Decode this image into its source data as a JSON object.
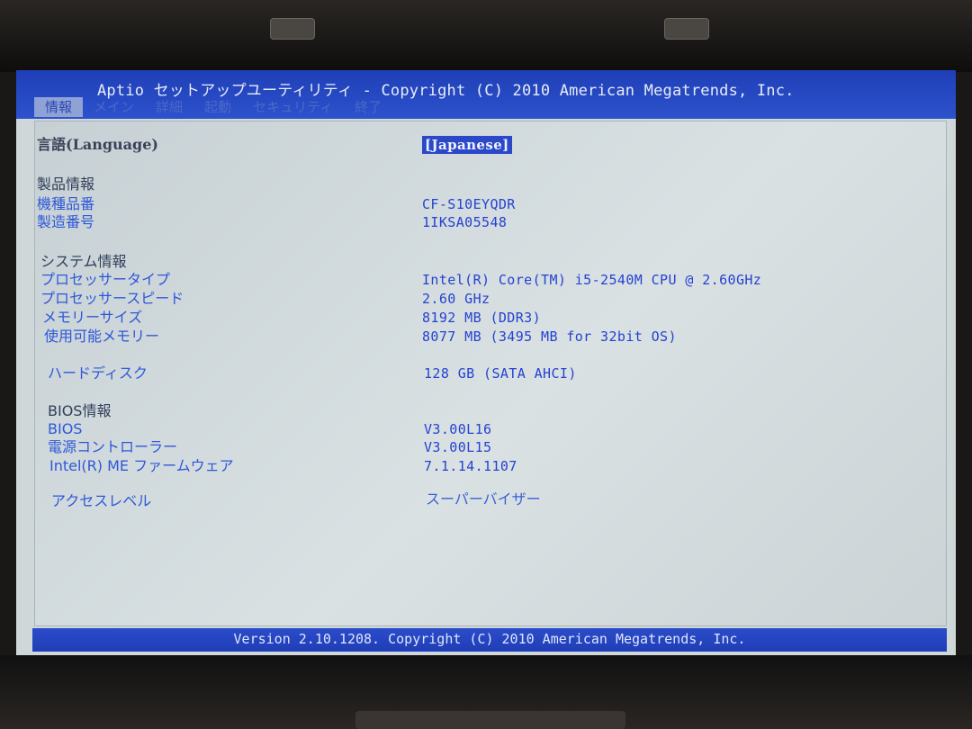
{
  "header": {
    "title": "Aptio セットアップユーティリティ - Copyright (C) 2010 American Megatrends, Inc.",
    "tabs": [
      "情報",
      "メイン",
      "詳細",
      "起動",
      "セキュリティ",
      "終了"
    ]
  },
  "rows": {
    "language": {
      "label": "言語(Language)",
      "value": "[Japanese]"
    },
    "product_heading": "製品情報",
    "model": {
      "label": "機種品番",
      "value": "CF-S10EYQDR"
    },
    "serial": {
      "label": "製造番号",
      "value": "1IKSA05548"
    },
    "system_heading": "システム情報",
    "cpu_type": {
      "label": "プロセッサータイプ",
      "value": "Intel(R) Core(TM) i5-2540M CPU @ 2.60GHz"
    },
    "cpu_speed": {
      "label": "プロセッサースピード",
      "value": "2.60 GHz"
    },
    "memory_size": {
      "label": "メモリーサイズ",
      "value": "8192 MB (DDR3)"
    },
    "usable_memory": {
      "label": "使用可能メモリー",
      "value": "8077 MB (3495 MB for 32bit OS)"
    },
    "hdd": {
      "label": "ハードディスク",
      "value": "128 GB (SATA AHCI)"
    },
    "bios_heading": "BIOS情報",
    "bios": {
      "label": "BIOS",
      "value": "V3.00L16"
    },
    "power_controller": {
      "label": "電源コントローラー",
      "value": "V3.00L15"
    },
    "me_firmware": {
      "label": "Intel(R) ME ファームウェア",
      "value": "7.1.14.1107"
    },
    "access_level": {
      "label": "アクセスレベル",
      "value": "スーパーバイザー"
    }
  },
  "footer": {
    "text": "Version 2.10.1208. Copyright (C) 2010 American Megatrends, Inc."
  },
  "colors": {
    "bar_blue": "#1f3fb8",
    "panel_bg": "#cfd7d9",
    "label_blue": "#2e58d8",
    "value_blue": "#2542d0"
  }
}
